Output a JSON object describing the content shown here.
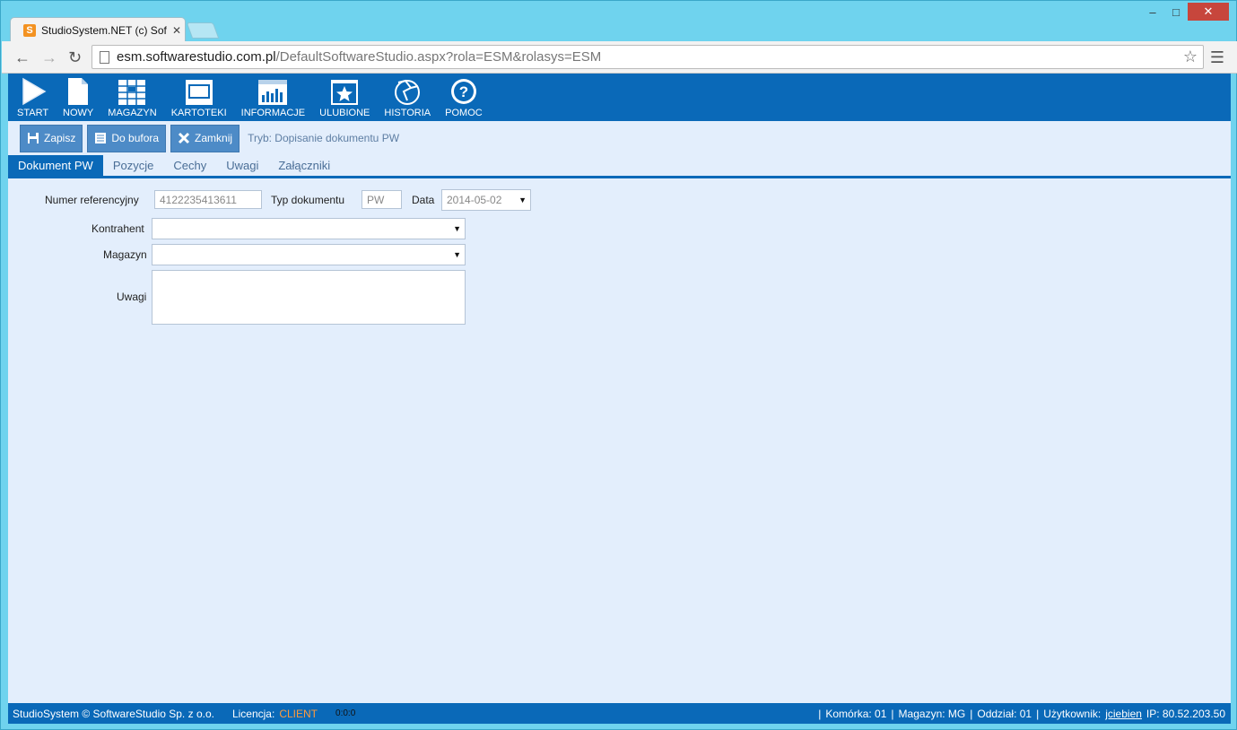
{
  "browser": {
    "tab_title": "StudioSystem.NET (c) Soft",
    "favicon_letter": "S",
    "url_host": "esm.softwarestudio.com.pl",
    "url_path": "/DefaultSoftwareStudio.aspx?rola=ESM&rolasys=ESM"
  },
  "topnav": {
    "items": [
      {
        "label": "START",
        "icon": "play-icon"
      },
      {
        "label": "NOWY",
        "icon": "new-document-icon"
      },
      {
        "label": "MAGAZYN",
        "icon": "warehouse-grid-icon"
      },
      {
        "label": "KARTOTEKI",
        "icon": "window-icon"
      },
      {
        "label": "INFORMACJE",
        "icon": "chart-icon"
      },
      {
        "label": "ULUBIONE",
        "icon": "star-icon"
      },
      {
        "label": "HISTORIA",
        "icon": "history-globe-icon"
      },
      {
        "label": "POMOC",
        "icon": "help-icon"
      }
    ]
  },
  "actions": {
    "save": "Zapisz",
    "to_buffer": "Do bufora",
    "close": "Zamknij",
    "mode": "Tryb: Dopisanie dokumentu PW"
  },
  "tabs": [
    "Dokument PW",
    "Pozycje",
    "Cechy",
    "Uwagi",
    "Załączniki"
  ],
  "form": {
    "ref_label": "Numer referencyjny",
    "ref_value": "4122235413611",
    "doctype_label": "Typ dokumentu",
    "doctype_value": "PW",
    "date_label": "Data",
    "date_value": "2014-05-02",
    "contractor_label": "Kontrahent",
    "contractor_value": "",
    "warehouse_label": "Magazyn",
    "warehouse_value": "",
    "notes_label": "Uwagi",
    "notes_value": ""
  },
  "status": {
    "copyright": "StudioSystem © SoftwareStudio Sp. z o.o.",
    "license_label": "Licencja:",
    "license_value": "CLIENT",
    "clock": "0:0:0",
    "cell": "Komórka: 01",
    "warehouse": "Magazyn: MG",
    "branch": "Oddział: 01",
    "user_label": "Użytkownik:",
    "user_value": "jciebien",
    "ip": "IP: 80.52.203.50"
  },
  "colors": {
    "brand": "#0a69b8",
    "button": "#4d8bc7",
    "background": "#e3eefc",
    "license": "#ff9a3d"
  }
}
